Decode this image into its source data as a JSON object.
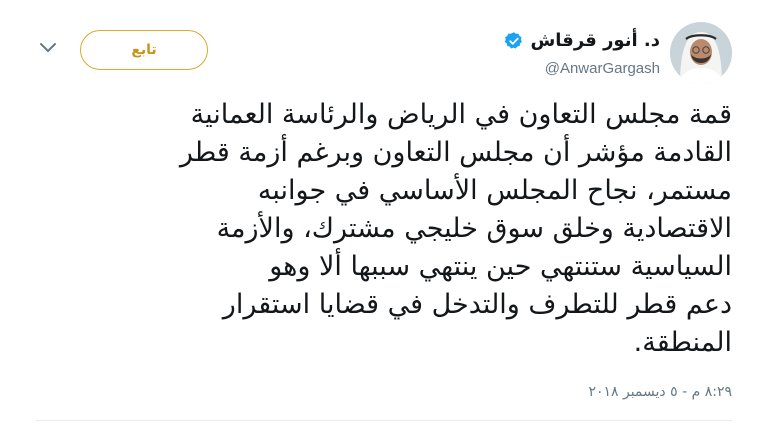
{
  "author": {
    "display_name": "د. أنور قرقاش",
    "handle": "@AnwarGargash",
    "verified": true
  },
  "follow_button": {
    "label": "تابع"
  },
  "tweet": {
    "lines": [
      "قمة مجلس التعاون في الرياض والرئاسة العمانية",
      "القادمة مؤشر أن مجلس التعاون وبرغم أزمة قطر",
      "مستمر، نجاح المجلس الأساسي في جوانبه",
      "الاقتصادية وخلق سوق خليجي مشترك، والأزمة",
      "السياسية ستنتهي حين ينتهي سببها ألا وهو",
      "دعم قطر للتطرف والتدخل في قضايا استقرار",
      "المنطقة."
    ],
    "timestamp": "٨:٢٩ م - ٥ ديسمبر ٢٠١٨"
  },
  "icons": {
    "verified": "verified-badge-icon",
    "more": "chevron-down-icon"
  },
  "colors": {
    "verified_blue": "#1da1f2",
    "follow_gold": "#d9aa2b",
    "text_primary": "#14171a",
    "text_secondary": "#657786"
  }
}
